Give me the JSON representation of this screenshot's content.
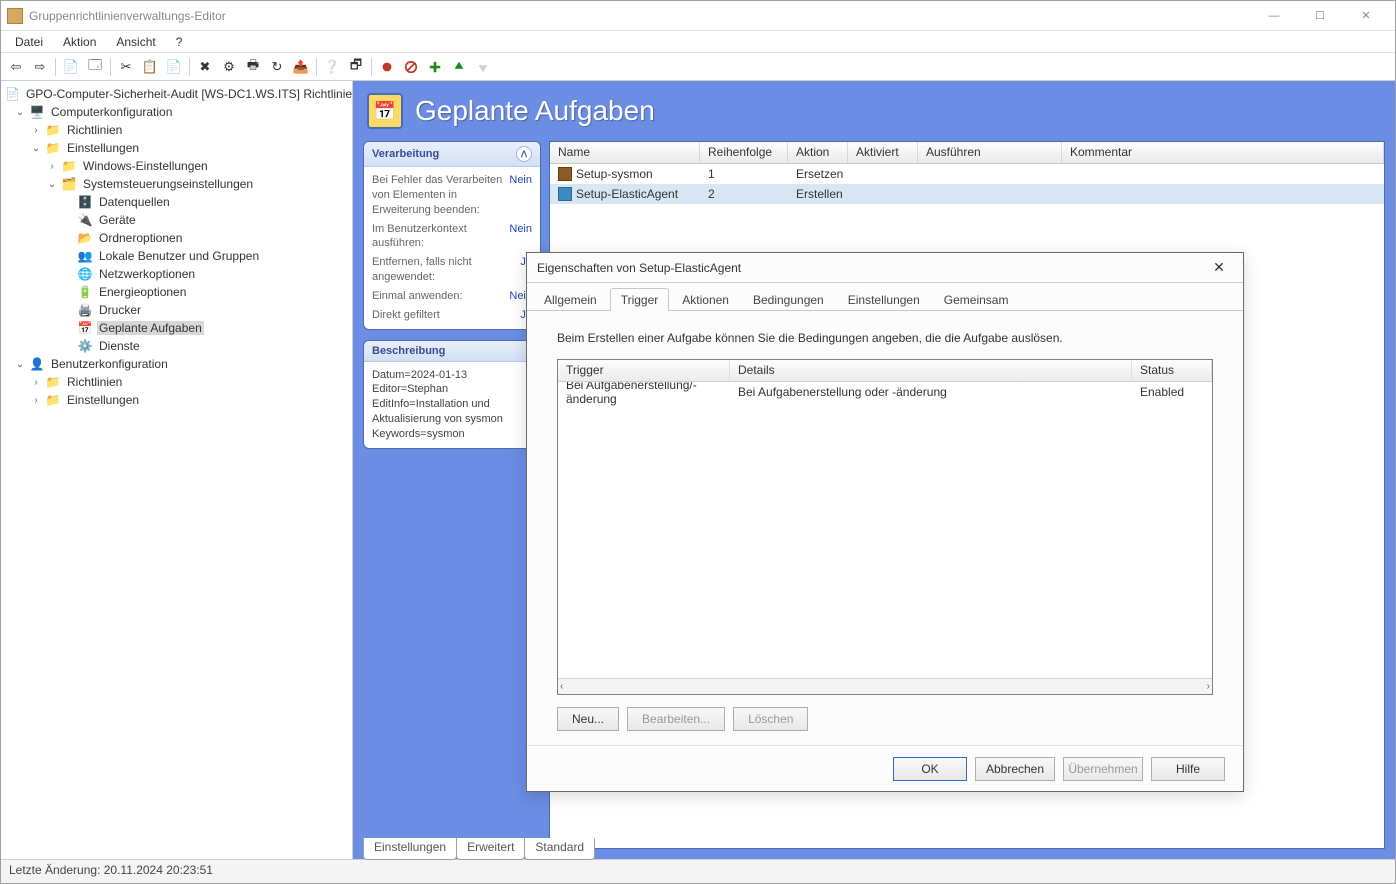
{
  "window": {
    "title": "Gruppenrichtlinienverwaltungs-Editor"
  },
  "menu": {
    "file": "Datei",
    "action": "Aktion",
    "view": "Ansicht",
    "help": "?"
  },
  "tree": {
    "root": "GPO-Computer-Sicherheit-Audit [WS-DC1.WS.ITS] Richtlinie",
    "computer_config": "Computerkonfiguration",
    "policies": "Richtlinien",
    "settings": "Einstellungen",
    "windows_settings": "Windows-Einstellungen",
    "control_panel": "Systemsteuerungseinstellungen",
    "data_sources": "Datenquellen",
    "devices": "Geräte",
    "folder_options": "Ordneroptionen",
    "local_users": "Lokale Benutzer und Gruppen",
    "network_options": "Netzwerkoptionen",
    "power_options": "Energieoptionen",
    "printers": "Drucker",
    "scheduled_tasks": "Geplante Aufgaben",
    "services": "Dienste",
    "user_config": "Benutzerkonfiguration",
    "user_policies": "Richtlinien",
    "user_settings": "Einstellungen"
  },
  "detail": {
    "title": "Geplante Aufgaben",
    "processing_card": {
      "header": "Verarbeitung",
      "r1k": "Bei Fehler das Verarbeiten von Elementen in Erweiterung beenden:",
      "r1v": "Nein",
      "r2k": "Im Benutzerkontext ausführen:",
      "r2v": "Nein",
      "r3k": "Entfernen, falls nicht angewendet:",
      "r3v": "Ja",
      "r4k": "Einmal anwenden:",
      "r4v": "Nein",
      "r5k": "Direkt gefiltert",
      "r5v": "Ja"
    },
    "description_card": {
      "header": "Beschreibung",
      "line1": "Datum=2024-01-13",
      "line2": "Editor=Stephan",
      "line3": "EditInfo=Installation und Aktualisierung von sysmon",
      "line4": "Keywords=sysmon"
    },
    "columns": {
      "name": "Name",
      "order": "Reihenfolge",
      "action": "Aktion",
      "activated": "Aktiviert",
      "run": "Ausführen",
      "comment": "Kommentar"
    },
    "rows": [
      {
        "name": "Setup-sysmon",
        "order": "1",
        "action": "Ersetzen"
      },
      {
        "name": "Setup-ElasticAgent",
        "order": "2",
        "action": "Erstellen"
      }
    ],
    "tabs": {
      "settings": "Einstellungen",
      "advanced": "Erweitert",
      "standard": "Standard"
    }
  },
  "dialog": {
    "title": "Eigenschaften von Setup-ElasticAgent",
    "tabs": {
      "general": "Allgemein",
      "trigger": "Trigger",
      "actions": "Aktionen",
      "conditions": "Bedingungen",
      "settings": "Einstellungen",
      "shared": "Gemeinsam"
    },
    "intro": "Beim Erstellen einer Aufgabe können Sie die Bedingungen angeben, die die Aufgabe auslösen.",
    "columns": {
      "trigger": "Trigger",
      "details": "Details",
      "status": "Status"
    },
    "row": {
      "trigger": "Bei Aufgabenerstellung/-änderung",
      "details": "Bei Aufgabenerstellung oder -änderung",
      "status": "Enabled"
    },
    "buttons": {
      "new": "Neu...",
      "edit": "Bearbeiten...",
      "delete": "Löschen",
      "ok": "OK",
      "cancel": "Abbrechen",
      "apply": "Übernehmen",
      "help": "Hilfe"
    }
  },
  "statusbar": {
    "text": "Letzte Änderung: 20.11.2024 20:23:51"
  }
}
